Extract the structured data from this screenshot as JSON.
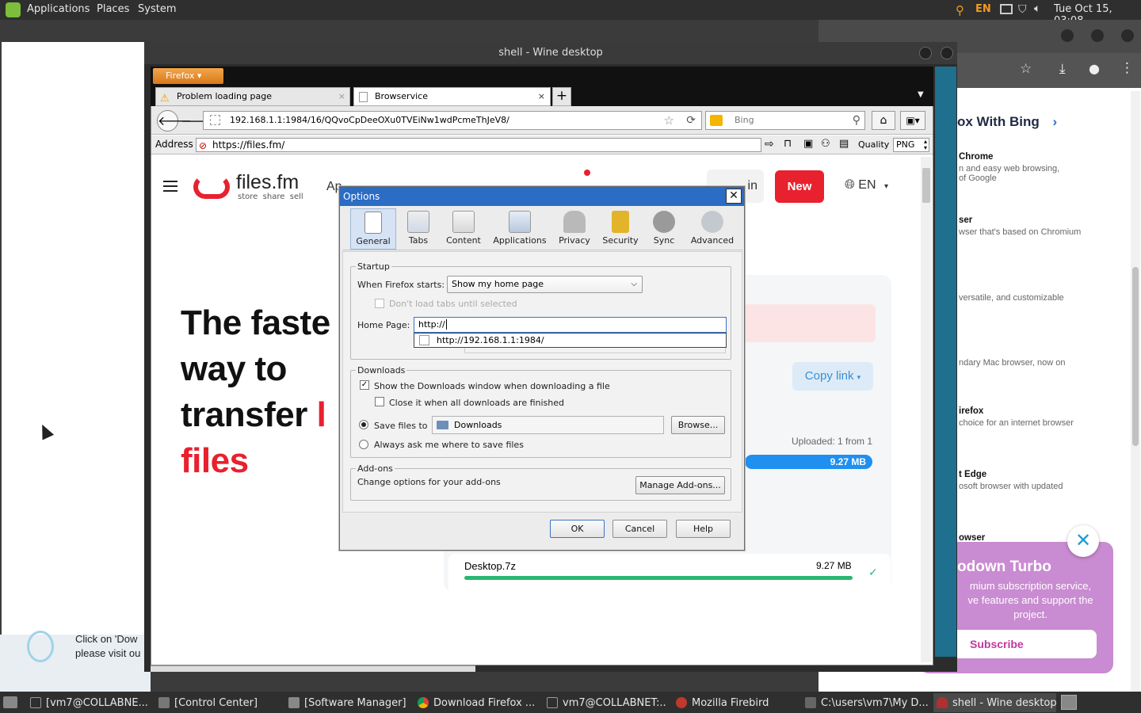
{
  "topbar": {
    "menus": [
      "Applications",
      "Places",
      "System"
    ],
    "lang": "EN",
    "clock": "Tue Oct 15, 03:08"
  },
  "chrome_bg": {
    "heading": "ox With Bing",
    "items": [
      {
        "title": "Chrome",
        "text": "n and easy web browsing,",
        "text2": "of Google"
      },
      {
        "title": "ser",
        "text": "wser that's based on Chromium",
        "text2": ""
      },
      {
        "title": "",
        "text": "versatile, and customizable",
        "text2": ""
      },
      {
        "title": "",
        "text": "ndary Mac browser, now on",
        "text2": ""
      },
      {
        "title": "irefox",
        "text": "choice for an internet browser",
        "text2": ""
      },
      {
        "title": "t Edge",
        "text": "osoft browser with updated",
        "text2": ""
      },
      {
        "title": "owser",
        "text": "",
        "text2": ""
      }
    ],
    "promo_title": "odown Turbo",
    "promo_l1": "mium subscription service,",
    "promo_l2": "ve features and support the",
    "promo_l3": "project.",
    "subscribe": "Subscribe",
    "behind_l1": "Click on 'Dow",
    "behind_l2": "please visit ou"
  },
  "wine": {
    "title": "shell - Wine desktop"
  },
  "firefox": {
    "menu_button": "Firefox",
    "tabs": [
      "Problem loading page",
      "Browservice"
    ],
    "url": "192.168.1.1:1984/16/QQvoCpDeeOXu0TVEiNw1wdPcmeThJeV8/",
    "search_engine": "Bing",
    "address_label": "Address",
    "address_value": "https://files.fm/",
    "quality_label": "Quality",
    "quality_value": "PNG"
  },
  "page": {
    "logo": "files.fm",
    "logo_sub": "store  share  sell",
    "nav_partial": "Ap",
    "login_partial": "in",
    "new_button": "New",
    "lang": "EN",
    "hero1": "The faste",
    "hero2": "way to",
    "hero3": "transfer",
    "hero3_red": "l",
    "hero4": "files",
    "copy_link": "Copy link",
    "uploaded": "Uploaded: 1 from 1",
    "size_bar": "9.27 MB",
    "file_name": "Desktop.7z",
    "file_size": "9.27 MB"
  },
  "dialog": {
    "title": "Options",
    "tabs": [
      "General",
      "Tabs",
      "Content",
      "Applications",
      "Privacy",
      "Security",
      "Sync",
      "Advanced"
    ],
    "startup_legend": "Startup",
    "when_starts_label": "When Firefox starts:",
    "when_starts_value": "Show my home page",
    "dont_load": "Don't load tabs until selected",
    "home_page_label": "Home Page:",
    "home_page_value": "http://",
    "autocomplete": "http://192.168.1.1:1984/",
    "downloads_legend": "Downloads",
    "show_downloads": "Show the Downloads window when downloading a file",
    "close_when": "Close it when all downloads are finished",
    "save_files": "Save files to",
    "save_folder": "Downloads",
    "browse": "Browse...",
    "always_ask": "Always ask me where to save files",
    "addons_legend": "Add-ons",
    "addons_text": "Change options for your add-ons",
    "manage_addons": "Manage Add-ons...",
    "ok": "OK",
    "cancel": "Cancel",
    "help": "Help"
  },
  "taskbar": [
    "[vm7@COLLABNE...",
    "[Control Center]",
    "[Software Manager]",
    "Download Firefox ...",
    "vm7@COLLABNET:...",
    "Mozilla Firebird",
    "C:\\users\\vm7\\My D...",
    "shell - Wine desktop"
  ],
  "colors": {
    "accent_red": "#e8212e",
    "dialog_title": "#2b6cc4",
    "progress_green": "#2bb673",
    "progress_blue": "#1f8ff0"
  }
}
